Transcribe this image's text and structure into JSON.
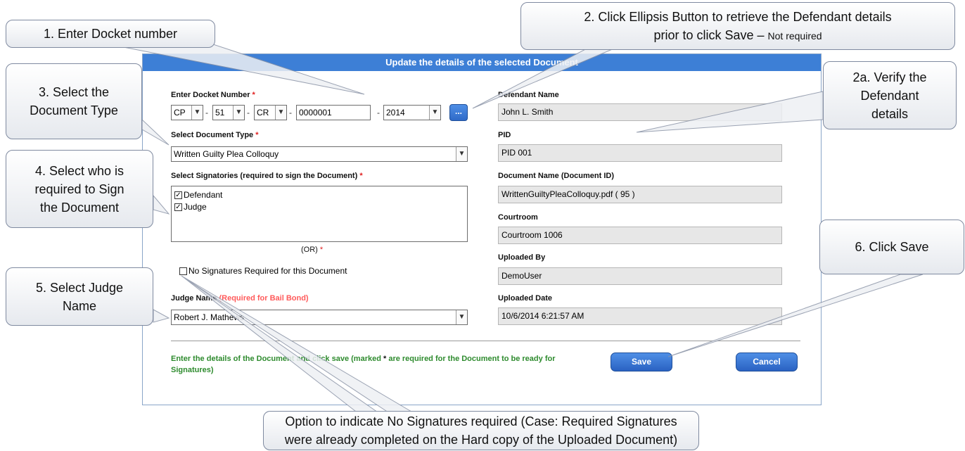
{
  "dialog": {
    "title": "Update the details of the selected Document",
    "docket": {
      "label": "Enter Docket Number",
      "required_mark": "*",
      "part1": "CP",
      "part2": "51",
      "part3": "CR",
      "number": "0000001",
      "year": "2014",
      "separator": "-",
      "ellipsis_label": "..."
    },
    "doc_type": {
      "label": "Select Document Type",
      "required_mark": "*",
      "value": "Written Guilty Plea Colloquy"
    },
    "signatories": {
      "label": "Select Signatories (required to sign the Document)",
      "required_mark": "*",
      "items": [
        {
          "label": "Defendant",
          "checked": true
        },
        {
          "label": "Judge",
          "checked": true
        }
      ]
    },
    "or_text": "(OR)",
    "or_required_mark": "*",
    "no_signatures": {
      "label": "No Signatures Required for this Document",
      "checked": false
    },
    "judge": {
      "label": "Judge Name",
      "note": "(Required for Bail Bond)",
      "value": "Robert J. Mathews"
    },
    "right": {
      "defendant_name": {
        "label": "Defendant Name",
        "value": "John L. Smith"
      },
      "pid": {
        "label": "PID",
        "value": "PID 001"
      },
      "document_name": {
        "label": "Document Name (Document ID)",
        "value": "WrittenGuiltyPleaColloquy.pdf ( 95 )"
      },
      "courtroom": {
        "label": "Courtroom",
        "value": "Courtroom 1006"
      },
      "uploaded_by": {
        "label": "Uploaded By",
        "value": "DemoUser"
      },
      "uploaded_date": {
        "label": "Uploaded Date",
        "value": "10/6/2014 6:21:57 AM"
      }
    },
    "instructions": {
      "before": "Enter the details of the Document and click save (marked ",
      "mark": "*",
      "after": " are required for the Document to be ready for Signatures)"
    },
    "save_label": "Save",
    "cancel_label": "Cancel"
  },
  "callouts": {
    "c1": "1. Enter Docket number",
    "c2_line1": "2. Click Ellipsis Button to retrieve the Defendant details",
    "c2_line2": "prior to click Save –",
    "c2_note": "Not required",
    "c2a_line1": "2a. Verify the",
    "c2a_line2": "Defendant",
    "c2a_line3": "details",
    "c3_line1": "3. Select the",
    "c3_line2": "Document Type",
    "c4_line1": "4. Select who is",
    "c4_line2": "required to  Sign",
    "c4_line3": "the Document",
    "c5_line1": "5. Select Judge",
    "c5_line2": "Name",
    "c6": "6. Click Save",
    "c7_line1": "Option to indicate No Signatures required (Case: Required Signatures",
    "c7_line2": "were already completed on the Hard copy of the Uploaded Document)"
  }
}
